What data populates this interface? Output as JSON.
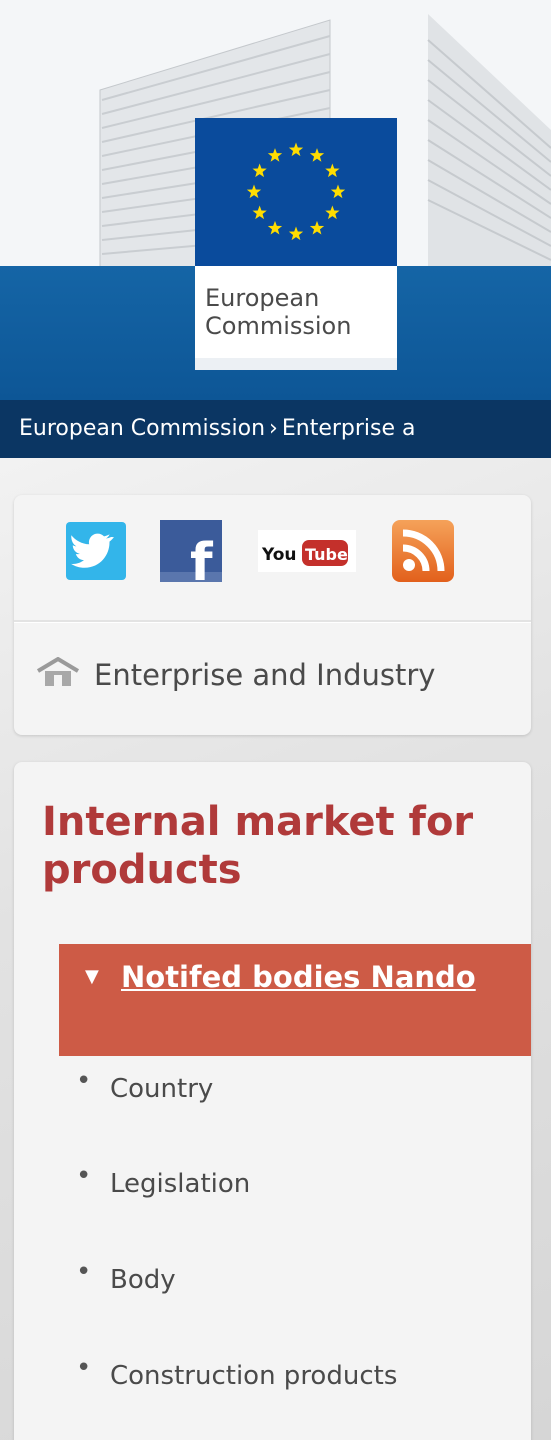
{
  "header": {
    "logo_line1": "European",
    "logo_line2": "Commission"
  },
  "breadcrumb": {
    "item1": "European Commission",
    "separator": "›",
    "item2": "Enterprise a"
  },
  "social": {
    "icons": [
      "twitter-icon",
      "facebook-icon",
      "youtube-icon",
      "rss-icon"
    ],
    "youtube_you": "You",
    "youtube_tube": "Tube",
    "facebook_letter": "f"
  },
  "nav": {
    "home_label": "Enterprise and Industry"
  },
  "section": {
    "title": "Internal market for products",
    "active_item": "Notifed bodies Nando",
    "subitems": [
      "Country",
      "Legislation",
      "Body",
      "Construction products"
    ]
  },
  "colors": {
    "header_blue": "#1565a6",
    "breadcrumb_bg": "#0b3663",
    "title_red": "#b03a3a",
    "active_bg": "#cd5b46",
    "eu_blue": "#0a4b9c",
    "eu_star": "#ffdd00"
  }
}
